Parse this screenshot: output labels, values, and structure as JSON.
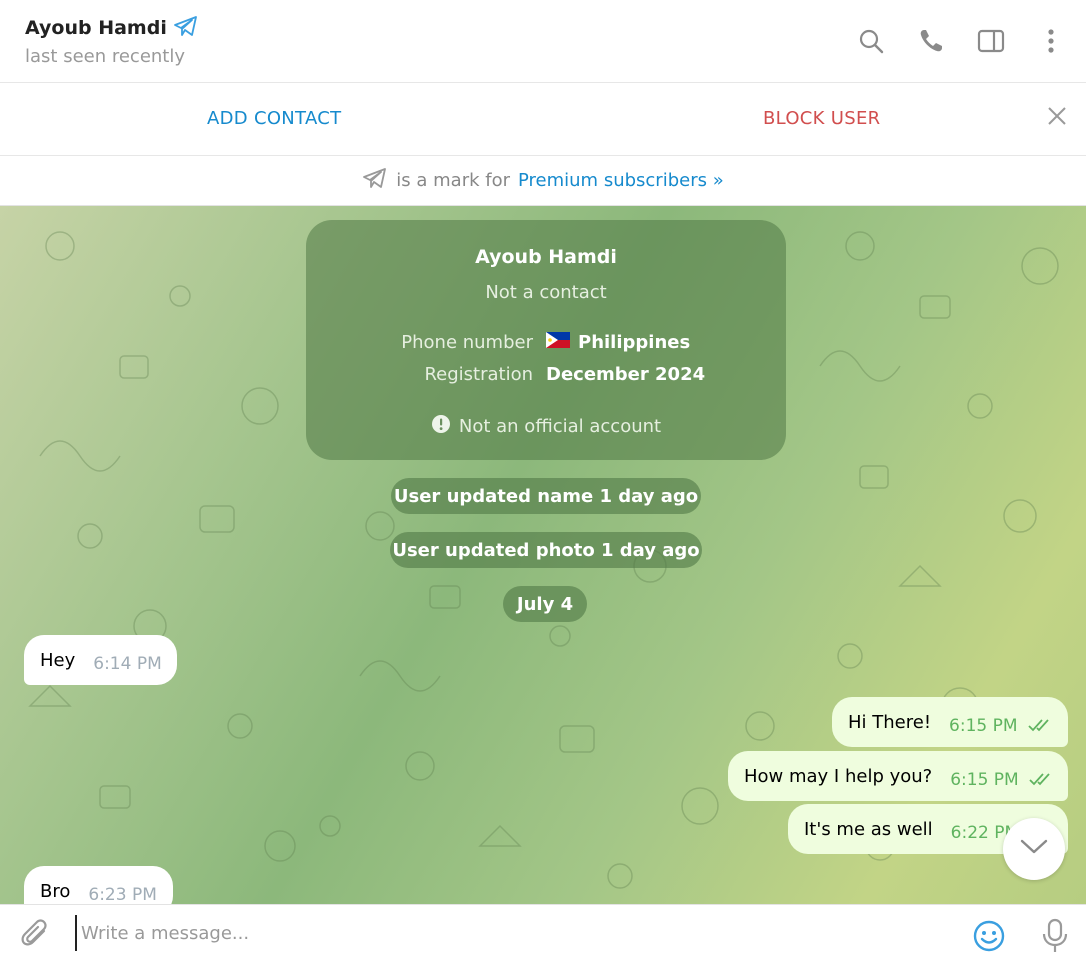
{
  "header": {
    "name": "Ayoub Hamdi",
    "status": "last seen recently",
    "icons": [
      "telegram-plane-icon",
      "search-icon",
      "phone-icon",
      "sidebar-toggle-icon",
      "more-vertical-icon"
    ]
  },
  "actionbar": {
    "add_contact": "ADD CONTACT",
    "block_user": "BLOCK USER"
  },
  "premium": {
    "text": "is a mark for",
    "link": "Premium subscribers »"
  },
  "infocard": {
    "title": "Ayoub Hamdi",
    "subtitle": "Not a contact",
    "phone_label": "Phone number",
    "phone_value": "Philippines",
    "registration_label": "Registration",
    "registration_value": "December 2024",
    "note": "Not an official account"
  },
  "service": {
    "name_update": "User updated name 1 day ago",
    "photo_update": "User updated photo 1 day ago",
    "date": "July 4"
  },
  "messages": [
    {
      "dir": "in",
      "text": "Hey",
      "time": "6:14 PM"
    },
    {
      "dir": "out",
      "text": "Hi There!",
      "time": "6:15 PM"
    },
    {
      "dir": "out",
      "text": "How may I help you?",
      "time": "6:15 PM"
    },
    {
      "dir": "out",
      "text": "It's me as well",
      "time": "6:22 PM"
    },
    {
      "dir": "in",
      "text": "Bro",
      "time": "6:23 PM"
    }
  ],
  "composer": {
    "placeholder": "Write a message..."
  },
  "colors": {
    "accent": "#168acd",
    "danger": "#d14e4e",
    "outgoing_bubble": "#effdde",
    "read_ticks": "#5fb35f"
  }
}
